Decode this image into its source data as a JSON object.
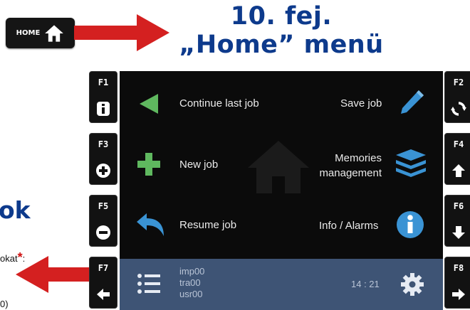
{
  "home_key": {
    "label": "HOME",
    "icon": "home-icon"
  },
  "title": {
    "line1": "10. fej.",
    "line2": "„Home” menü"
  },
  "fragments": {
    "heading": "ok",
    "text": "okat",
    "asterisk": "*",
    "colon": ":",
    "paren": "0)"
  },
  "fkeys": {
    "f1": {
      "label": "F1",
      "icon": "info-icon"
    },
    "f2": {
      "label": "F2",
      "icon": "refresh-icon"
    },
    "f3": {
      "label": "F3",
      "icon": "plus-icon"
    },
    "f4": {
      "label": "F4",
      "icon": "arrow-up-icon"
    },
    "f5": {
      "label": "F5",
      "icon": "minus-icon"
    },
    "f6": {
      "label": "F6",
      "icon": "arrow-down-icon"
    },
    "f7": {
      "label": "F7",
      "icon": "arrow-left-icon"
    },
    "f8": {
      "label": "F8",
      "icon": "arrow-right-icon"
    }
  },
  "menu": {
    "continue_last_job": "Continue last job",
    "save_job": "Save job",
    "new_job": "New job",
    "memories_line1": "Memories",
    "memories_line2": "management",
    "resume_job": "Resume job",
    "info_alarms": "Info / Alarms"
  },
  "status": {
    "users": [
      "imp00",
      "tra00",
      "usr00"
    ],
    "time": "14 : 21"
  },
  "colors": {
    "title": "#0d3a8c",
    "arrow": "#d42020",
    "green": "#5fb85f",
    "blue": "#3a93d4",
    "status_bar": "#3e5475"
  }
}
